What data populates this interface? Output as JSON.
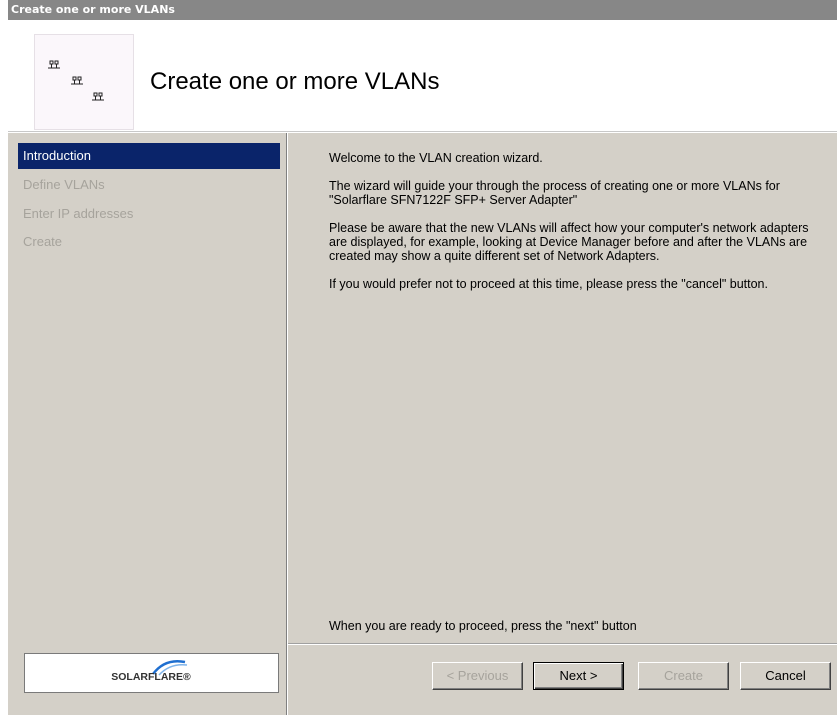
{
  "window": {
    "title": "Create one or more VLANs"
  },
  "header": {
    "title": "Create one or more VLANs",
    "icon": "network-icon"
  },
  "sidebar": {
    "steps": [
      {
        "label": "Introduction",
        "active": true
      },
      {
        "label": "Define VLANs",
        "active": false
      },
      {
        "label": "Enter IP addresses",
        "active": false
      },
      {
        "label": "Create",
        "active": false
      }
    ],
    "brand": "SOLARFLARE®"
  },
  "content": {
    "paragraphs": [
      "Welcome to the VLAN creation wizard.",
      "The wizard will guide your through the process of creating one or more VLANs for \"Solarflare SFN7122F SFP+ Server Adapter\"",
      "Please be aware that the new VLANs will affect how your computer's network adapters are displayed, for example, looking at Device Manager before and after the VLANs are created may show a quite different set of Network Adapters.",
      "If you would prefer not to proceed at this time, please press the \"cancel\" button."
    ],
    "ready_text": "When you are ready to proceed, press the \"next\" button"
  },
  "buttons": {
    "previous": "< Previous",
    "next": "Next >",
    "create": "Create",
    "cancel": "Cancel"
  },
  "colors": {
    "selection": "#0a246a",
    "dialog_bg": "#d4d0c8",
    "titlebar": "#878787",
    "brand_blue": "#1f6fd0"
  }
}
